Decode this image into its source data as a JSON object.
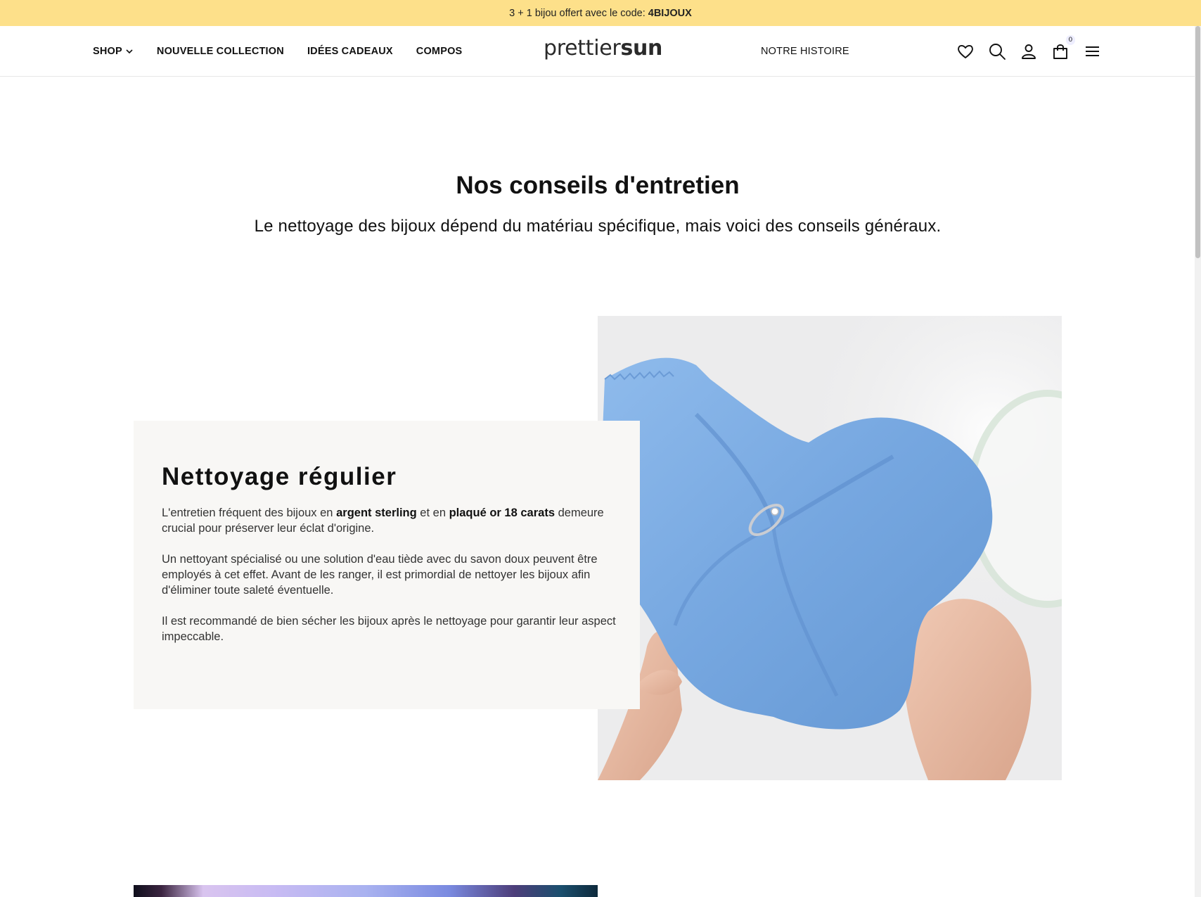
{
  "announcement": {
    "text": "3 + 1 bijou offert avec le code:",
    "code": "4BIJOUX"
  },
  "header": {
    "nav_left": [
      {
        "label": "SHOP",
        "has_dropdown": true
      },
      {
        "label": "NOUVELLE COLLECTION"
      },
      {
        "label": "IDÉES CADEAUX"
      },
      {
        "label": "COMPOS"
      }
    ],
    "logo_light": "prettier",
    "logo_bold": "sun",
    "nav_right": "NOTRE HISTOIRE",
    "cart_count": "0",
    "icons": [
      "heart-icon",
      "search-icon",
      "user-icon",
      "cart-icon",
      "menu-icon"
    ]
  },
  "hero": {
    "title": "Nos conseils d'entretien",
    "subtitle": "Le nettoyage des bijoux dépend du matériau spécifique, mais voici des conseils généraux."
  },
  "card": {
    "title": "Nettoyage régulier",
    "p1_a": "L'entretien fréquent des bijoux en",
    "p1_b": "argent sterling",
    "p1_c": "et en",
    "p1_d": "plaqué or 18 carats",
    "p1_e": "demeure crucial pour préserver leur éclat d'origine.",
    "p2": "Un nettoyant spécialisé ou une solution d'eau tiède avec du savon doux peuvent être employés à cet effet. Avant de les ranger, il est primordial de nettoyer les bijoux afin d'éliminer toute saleté éventuelle.",
    "p3": "Il est recommandé de bien sécher les bijoux après le nettoyage pour garantir leur aspect impeccable."
  },
  "colors": {
    "announcement_bg": "#fde08a",
    "card_bg": "#f8f7f5",
    "cloth_blue": "#7eaee6"
  }
}
